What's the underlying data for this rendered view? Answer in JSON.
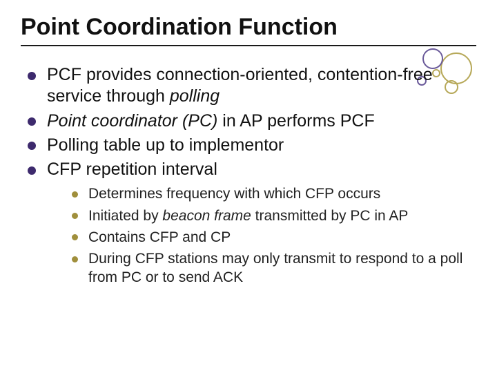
{
  "title": "Point Coordination Function",
  "main_items": [
    {
      "pre": "PCF provides connection-oriented, contention-free service through ",
      "em": "polling",
      "post": ""
    },
    {
      "pre": "",
      "em": "Point coordinator (PC)",
      "post": " in AP performs PCF"
    },
    {
      "pre": "Polling table up to implementor",
      "em": "",
      "post": ""
    },
    {
      "pre": "CFP repetition interval",
      "em": "",
      "post": ""
    }
  ],
  "sub_items": [
    {
      "pre": "Determines frequency with which CFP occurs",
      "em": "",
      "post": ""
    },
    {
      "pre": "Initiated by ",
      "em": "beacon frame",
      "post": " transmitted by PC in AP"
    },
    {
      "pre": "Contains CFP and CP",
      "em": "",
      "post": ""
    },
    {
      "pre": "During CFP stations may only transmit to respond to a poll from PC or to send ACK",
      "em": "",
      "post": ""
    }
  ]
}
